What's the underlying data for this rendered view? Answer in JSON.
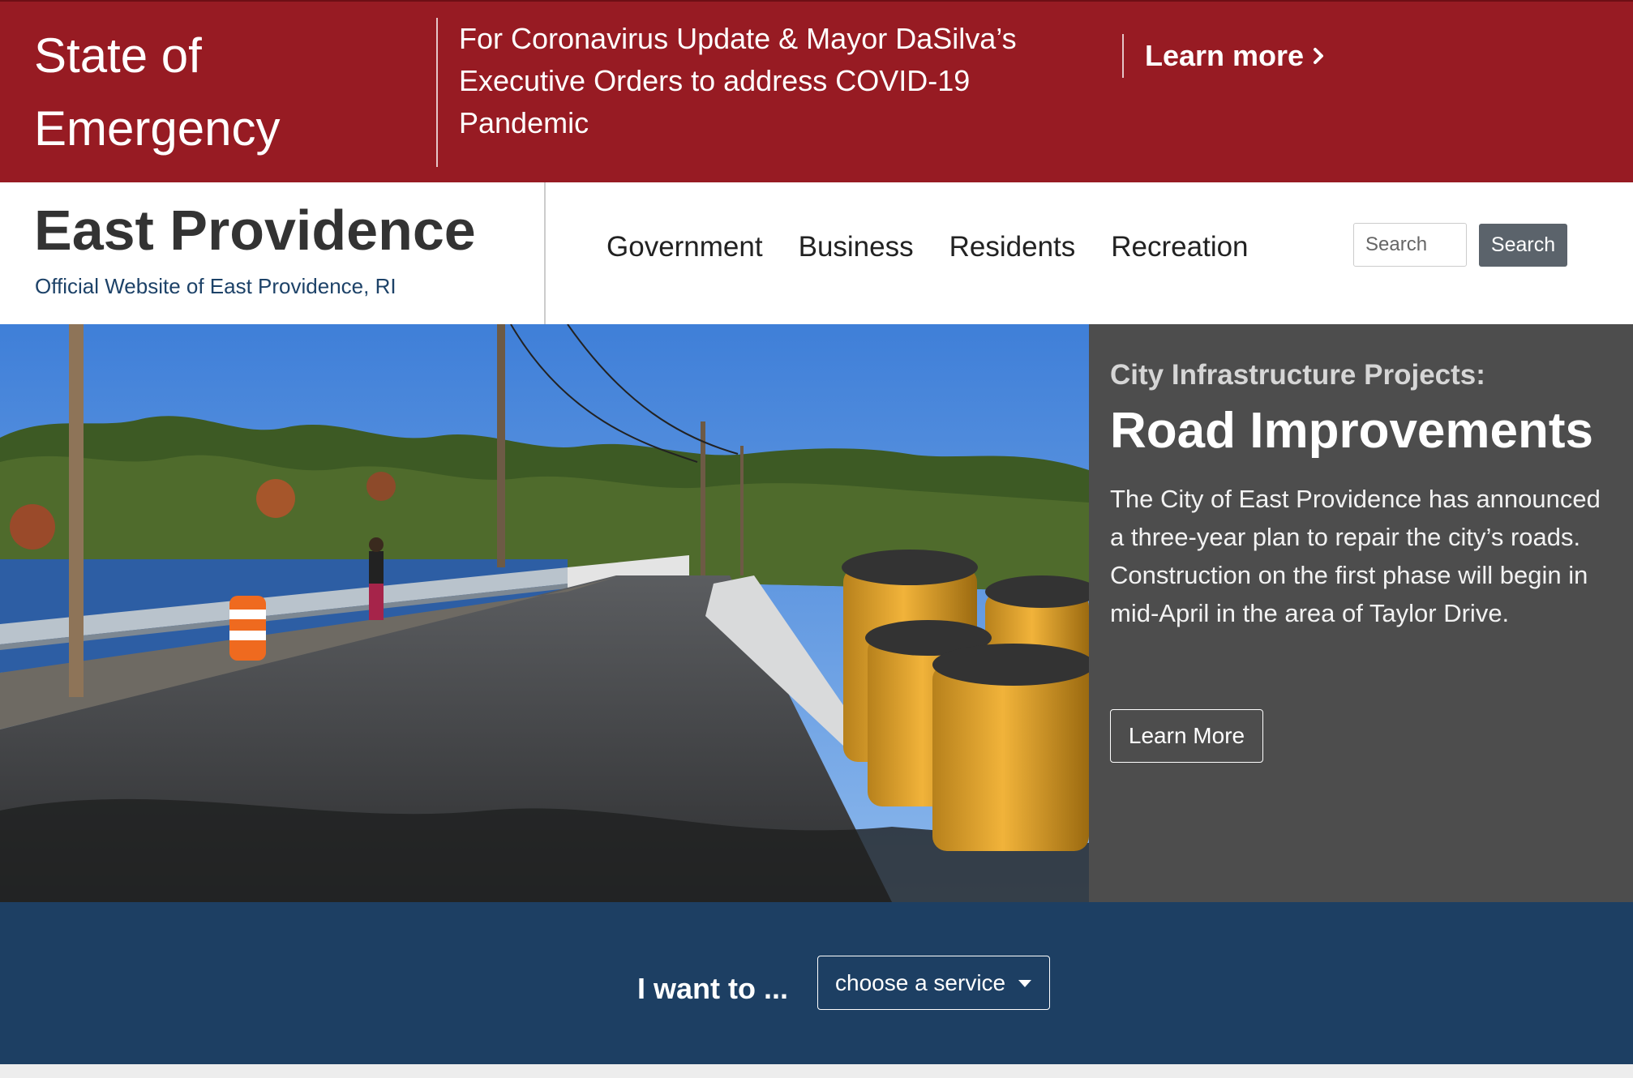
{
  "alert": {
    "title": "State of Emergency",
    "message": "For Coronavirus Update & Mayor DaSilva’s Executive Orders to address COVID-19 Pandemic",
    "link_label": "Learn more"
  },
  "header": {
    "site_title": "East Providence",
    "tagline": "Official Website of East Providence, RI",
    "nav": [
      "Government",
      "Business",
      "Residents",
      "Recreation"
    ],
    "search_placeholder": "Search",
    "search_button": "Search"
  },
  "hero": {
    "kicker": "City Infrastructure Projects:",
    "title": "Road Improvements",
    "body": "The City of East Providence has announced a three-year plan to repair the city’s roads. Construction on the first phase will begin in mid-April in the area of Taylor Drive.",
    "button": "Learn More"
  },
  "service": {
    "label": "I want to ...",
    "select_value": "choose a service"
  },
  "colors": {
    "alert_bg": "#971b23",
    "service_bg": "#1d3f63",
    "panel_bg": "#4d4d4d",
    "search_button_bg": "#5b636b"
  },
  "icons": {
    "alert_link": "chevron-right-icon",
    "select": "caret-down-icon"
  }
}
